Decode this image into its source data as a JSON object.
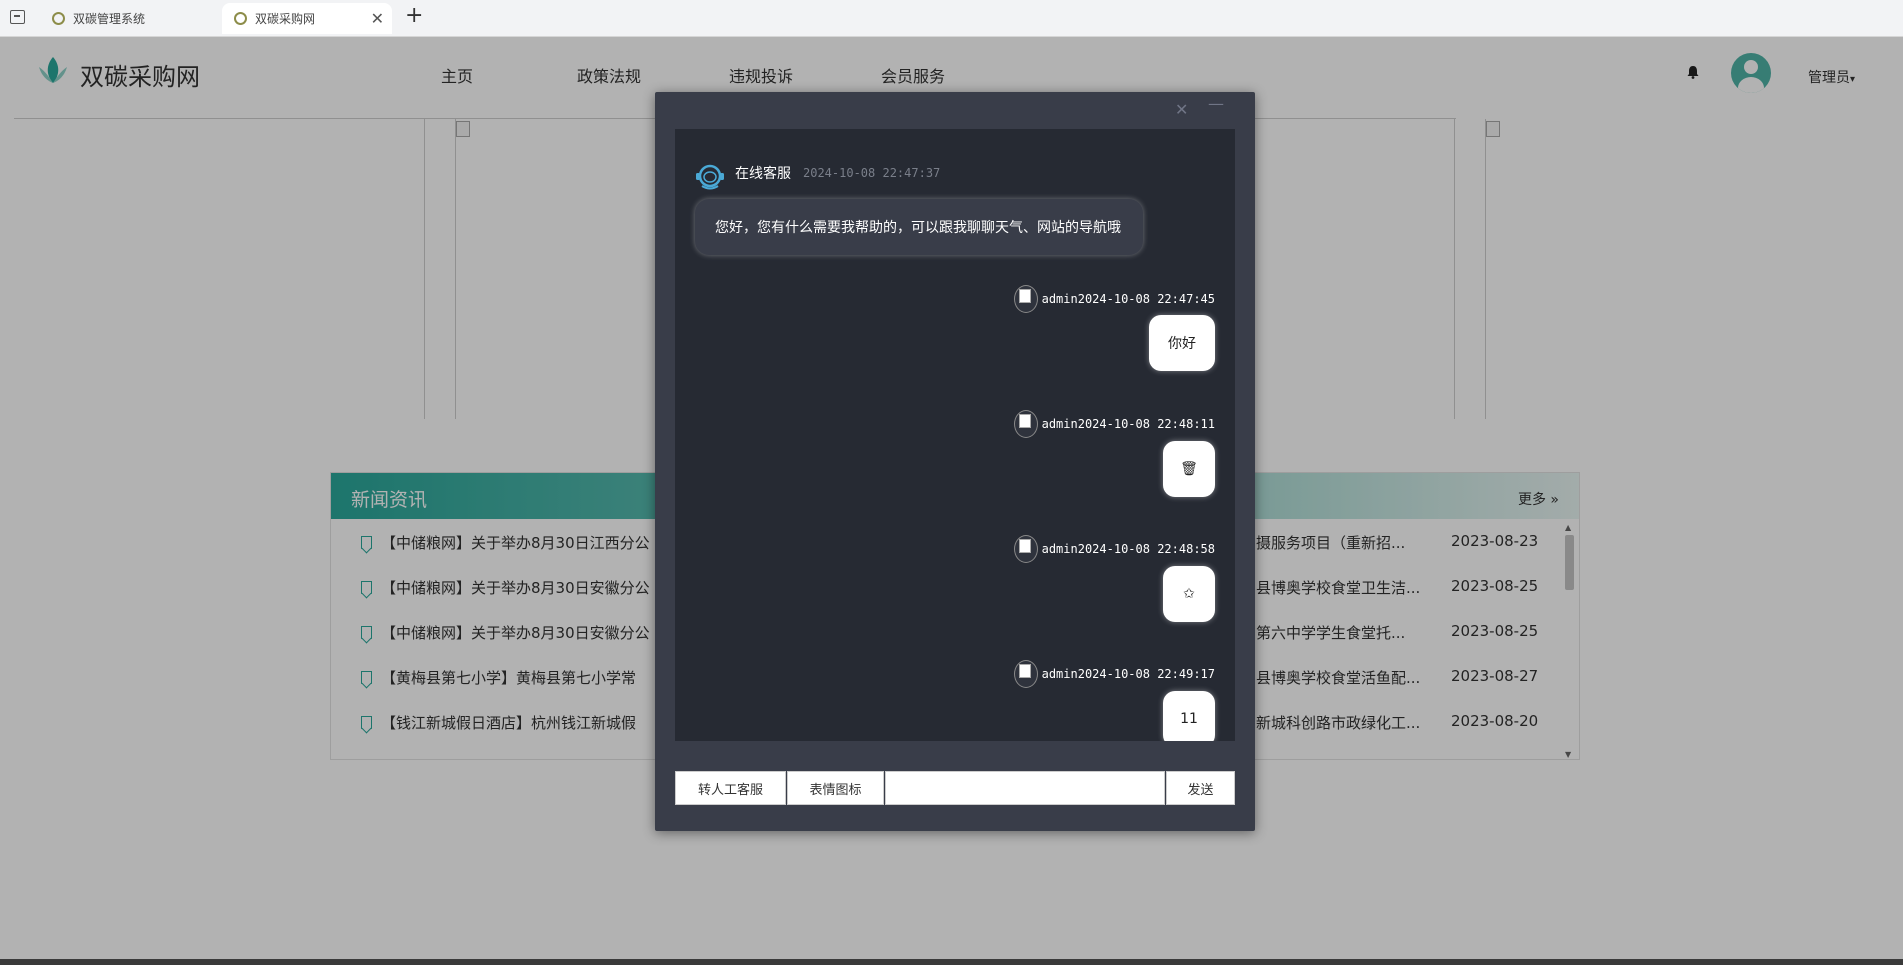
{
  "browser": {
    "tabs": [
      {
        "label": "双碳管理系统",
        "active": false
      },
      {
        "label": "双碳采购网",
        "active": true
      }
    ],
    "new_tab_label": "+",
    "close_label": "✕"
  },
  "site": {
    "logo_text": "双碳采购网",
    "nav": [
      "主页",
      "政策法规",
      "违规投诉",
      "会员服务"
    ],
    "user_menu": "管理员",
    "caret": "▾",
    "accent_color": "#2aa89b"
  },
  "news": {
    "title": "新闻资讯",
    "more": "更多 »",
    "rows": [
      {
        "left": "【中储粮网】关于举办8月30日江西分公",
        "right": "摄服务项目（重新招...",
        "date": "2023-08-23"
      },
      {
        "left": "【中储粮网】关于举办8月30日安徽分公",
        "right": "县博奥学校食堂卫生洁...",
        "date": "2023-08-25"
      },
      {
        "left": "【中储粮网】关于举办8月30日安徽分公",
        "right": "第六中学学生食堂托...",
        "date": "2023-08-25"
      },
      {
        "left": "【黄梅县第七小学】黄梅县第七小学常",
        "right": "县博奥学校食堂活鱼配...",
        "date": "2023-08-27"
      },
      {
        "left": "【钱江新城假日酒店】杭州钱江新城假",
        "right": "新城科创路市政绿化工...",
        "date": "2023-08-20"
      }
    ]
  },
  "chat": {
    "close_label": "✕",
    "min_label": "—",
    "bot": {
      "name": "在线客服",
      "time": "2024-10-08 22:47:37",
      "message": "您好，您有什么需要我帮助的，可以跟我聊聊天气、网站的导航哦"
    },
    "messages": [
      {
        "header": "admin2024-10-08 22:47:45",
        "content": "你好"
      },
      {
        "header": "admin2024-10-08 22:48:11",
        "content": "🗑"
      },
      {
        "header": "admin2024-10-08 22:48:58",
        "content": "✩"
      },
      {
        "header": "admin2024-10-08 22:49:17",
        "content": "11"
      }
    ],
    "buttons": {
      "transfer": "转人工客服",
      "emoji": "表情图标",
      "send": "发送"
    },
    "input_placeholder": ""
  }
}
